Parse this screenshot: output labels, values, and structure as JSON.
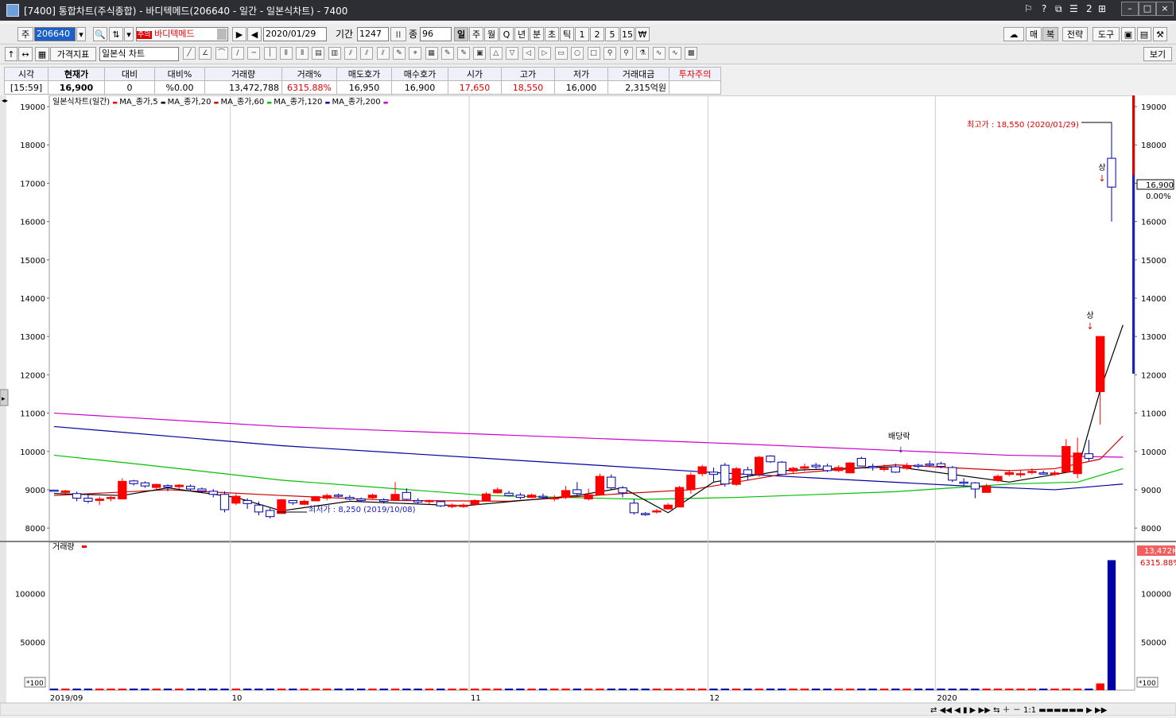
{
  "window": {
    "title": "[7400] 통합차트(주식종합) - 바디텍메드(206640 - 일간 - 일본식차트) - 7400",
    "controls": [
      "?",
      "2"
    ],
    "buttons": [
      "–",
      "□",
      "×"
    ]
  },
  "toolbar1": {
    "market_label": "주",
    "code": "206640",
    "warn_badge": "주의",
    "stock_name": "바디텍메드",
    "date": "2020/01/29",
    "period_label": "기간",
    "period_value": "1247",
    "count_label": "종",
    "count_value": "96",
    "intervals": [
      "일",
      "주",
      "월",
      "Q",
      "년",
      "분",
      "초",
      "틱",
      "1",
      "2",
      "5",
      "15",
      "₩"
    ],
    "right_buttons": [
      "매",
      "복",
      "전략",
      "도구"
    ]
  },
  "toolbar2": {
    "indicator_label": "가격지표",
    "chart_type": "일본식 차트",
    "view_button": "보기"
  },
  "quote": {
    "headers": [
      "시각",
      "현재가",
      "대비",
      "대비%",
      "거래량",
      "거래%",
      "매도호가",
      "매수호가",
      "시가",
      "고가",
      "저가",
      "거래대금",
      "투자주의"
    ],
    "values": [
      "[15:59]",
      "16,900",
      "0",
      "%0.00",
      "13,472,788",
      "6315.88%",
      "16,950",
      "16,900",
      "17,650",
      "18,550",
      "16,000",
      "2,315억원",
      ""
    ]
  },
  "colors": {
    "up": "#ff0000",
    "down": "#0000aa",
    "ma5": "#000000",
    "ma20": "#d00000",
    "ma60": "#00c000",
    "ma120": "#0000a0",
    "ma200": "#cc00cc"
  },
  "chart_data": {
    "type": "candlestick",
    "legend": [
      "일본식차트(일간)",
      "MA_종가,5",
      "MA_종가,20",
      "MA_종가,60",
      "MA_종가,120",
      "MA_종가,200"
    ],
    "volume_legend": "거래량",
    "price_ticks": [
      8000,
      9000,
      10000,
      11000,
      12000,
      13000,
      14000,
      15000,
      16000,
      17000,
      18000,
      19000
    ],
    "volume_ticks": [
      50000,
      100000
    ],
    "volume_unit": "*100",
    "x_labels": [
      "2019/09",
      "10",
      "11",
      "12",
      "2020"
    ],
    "x_label_index": [
      0,
      16,
      37,
      58,
      78
    ],
    "last_price_label": "16,900",
    "last_change_label": "0.00%",
    "last_volume_label": "13,472K",
    "last_volume_pct": "6315.88%",
    "high_annotation": "최고가 : 18,550 (2020/01/29)",
    "low_annotation": "최저가 : 8,250 (2019/10/08)",
    "dividend_annotation": "배당락",
    "limit_up_label": "상",
    "candles": [
      [
        8990,
        8990,
        8980,
        8980,
        140
      ],
      [
        8930,
        9000,
        8900,
        8970,
        160
      ],
      [
        8900,
        8950,
        8700,
        8780,
        340
      ],
      [
        8780,
        8880,
        8650,
        8700,
        180
      ],
      [
        8720,
        8820,
        8600,
        8760,
        140
      ],
      [
        8780,
        8830,
        8700,
        8800,
        220
      ],
      [
        8760,
        9300,
        8760,
        9220,
        620
      ],
      [
        9230,
        9260,
        9110,
        9160,
        230
      ],
      [
        9180,
        9220,
        9050,
        9100,
        200
      ],
      [
        9060,
        9160,
        8990,
        9140,
        190
      ],
      [
        9110,
        9140,
        8960,
        9070,
        160
      ],
      [
        9080,
        9150,
        9010,
        9120,
        170
      ],
      [
        9090,
        9140,
        8960,
        9020,
        200
      ],
      [
        9020,
        9060,
        8930,
        8970,
        150
      ],
      [
        8960,
        9020,
        8800,
        8880,
        190
      ],
      [
        8880,
        8960,
        8410,
        8480,
        390
      ],
      [
        8650,
        8890,
        8600,
        8830,
        310
      ],
      [
        8720,
        8780,
        8500,
        8640,
        260
      ],
      [
        8600,
        8690,
        8330,
        8420,
        290
      ],
      [
        8460,
        8520,
        8250,
        8300,
        360
      ],
      [
        8380,
        8760,
        8380,
        8740,
        410
      ],
      [
        8720,
        8730,
        8600,
        8660,
        180
      ],
      [
        8620,
        8740,
        8600,
        8700,
        170
      ],
      [
        8710,
        8840,
        8700,
        8820,
        190
      ],
      [
        8780,
        8900,
        8720,
        8850,
        180
      ],
      [
        8860,
        8900,
        8800,
        8840,
        150
      ],
      [
        8800,
        8860,
        8730,
        8760,
        140
      ],
      [
        8760,
        8800,
        8690,
        8720,
        150
      ],
      [
        8790,
        8900,
        8740,
        8860,
        160
      ],
      [
        8740,
        8780,
        8640,
        8700,
        150
      ],
      [
        8740,
        9200,
        8740,
        8880,
        560
      ],
      [
        8930,
        9040,
        8720,
        8750,
        310
      ],
      [
        8720,
        8780,
        8630,
        8680,
        180
      ],
      [
        8690,
        8740,
        8620,
        8720,
        160
      ],
      [
        8690,
        8710,
        8550,
        8580,
        200
      ],
      [
        8560,
        8640,
        8520,
        8600,
        180
      ],
      [
        8560,
        8640,
        8530,
        8600,
        170
      ],
      [
        8620,
        8750,
        8590,
        8720,
        210
      ],
      [
        8720,
        8940,
        8700,
        8890,
        330
      ],
      [
        8920,
        9060,
        8900,
        9000,
        290
      ],
      [
        8910,
        8970,
        8820,
        8850,
        180
      ],
      [
        8860,
        8920,
        8750,
        8800,
        170
      ],
      [
        8800,
        8900,
        8780,
        8860,
        160
      ],
      [
        8830,
        8900,
        8770,
        8810,
        170
      ],
      [
        8780,
        8860,
        8700,
        8790,
        180
      ],
      [
        8800,
        9100,
        8760,
        8980,
        460
      ],
      [
        9000,
        9200,
        8830,
        8900,
        520
      ],
      [
        8760,
        9030,
        8720,
        8870,
        280
      ],
      [
        8870,
        9420,
        8850,
        9350,
        1060
      ],
      [
        9330,
        9400,
        9000,
        9050,
        720
      ],
      [
        9050,
        9100,
        8800,
        8920,
        620
      ],
      [
        8650,
        8760,
        8350,
        8400,
        640
      ],
      [
        8380,
        8420,
        8320,
        8370,
        420
      ],
      [
        8420,
        8500,
        8380,
        8450,
        350
      ],
      [
        8500,
        8650,
        8480,
        8600,
        380
      ],
      [
        8550,
        9100,
        8550,
        9060,
        760
      ],
      [
        9000,
        9450,
        8900,
        9380,
        1040
      ],
      [
        9420,
        9650,
        9350,
        9600,
        780
      ],
      [
        9460,
        9580,
        9200,
        9400,
        650
      ],
      [
        9640,
        9700,
        9080,
        9150,
        1030
      ],
      [
        9140,
        9600,
        9100,
        9550,
        540
      ],
      [
        9520,
        9600,
        9250,
        9400,
        420
      ],
      [
        9400,
        9880,
        9340,
        9850,
        680
      ],
      [
        9880,
        9900,
        9700,
        9730,
        420
      ],
      [
        9720,
        9750,
        9380,
        9400,
        380
      ],
      [
        9490,
        9600,
        9420,
        9560,
        300
      ],
      [
        9560,
        9680,
        9480,
        9600,
        240
      ],
      [
        9640,
        9700,
        9550,
        9600,
        220
      ],
      [
        9620,
        9680,
        9460,
        9500,
        200
      ],
      [
        9500,
        9640,
        9460,
        9580,
        190
      ],
      [
        9440,
        9720,
        9440,
        9700,
        380
      ],
      [
        9820,
        9860,
        9610,
        9620,
        340
      ],
      [
        9610,
        9680,
        9500,
        9590,
        230
      ],
      [
        9530,
        9660,
        9480,
        9560,
        220
      ],
      [
        9600,
        9680,
        9440,
        9460,
        410
      ],
      [
        9560,
        9700,
        9520,
        9620,
        260
      ],
      [
        9640,
        9680,
        9560,
        9610,
        220
      ],
      [
        9670,
        9760,
        9600,
        9640,
        260
      ],
      [
        9680,
        9730,
        9560,
        9610,
        210
      ],
      [
        9580,
        9620,
        9200,
        9250,
        290
      ],
      [
        9200,
        9300,
        9100,
        9180,
        210
      ],
      [
        9180,
        9200,
        8780,
        9020,
        200
      ],
      [
        8930,
        9160,
        8930,
        9100,
        220
      ],
      [
        9240,
        9400,
        9200,
        9350,
        390
      ],
      [
        9400,
        9520,
        9350,
        9450,
        290
      ],
      [
        9420,
        9500,
        9320,
        9420,
        250
      ],
      [
        9460,
        9560,
        9400,
        9480,
        230
      ],
      [
        9440,
        9500,
        9400,
        9420,
        210
      ],
      [
        9400,
        9500,
        9360,
        9440,
        260
      ],
      [
        9460,
        10320,
        9460,
        10130,
        1470
      ],
      [
        9420,
        10360,
        9300,
        9960,
        880
      ],
      [
        9940,
        10300,
        9750,
        9820,
        740
      ],
      [
        11560,
        11560,
        10700,
        13000,
        6970
      ],
      [
        17650,
        18550,
        16000,
        16900,
        134728
      ]
    ],
    "ma_series": {
      "ma200": [
        [
          0,
          11000
        ],
        [
          20,
          10650
        ],
        [
          60,
          10200
        ],
        [
          84,
          9900
        ],
        [
          94,
          9850
        ]
      ],
      "ma120": [
        [
          0,
          10650
        ],
        [
          20,
          10150
        ],
        [
          58,
          9450
        ],
        [
          80,
          9100
        ],
        [
          88,
          9000
        ],
        [
          94,
          9150
        ]
      ],
      "ma60": [
        [
          0,
          9900
        ],
        [
          8,
          9650
        ],
        [
          20,
          9250
        ],
        [
          38,
          8850
        ],
        [
          52,
          8750
        ],
        [
          60,
          8800
        ],
        [
          74,
          8950
        ],
        [
          84,
          9150
        ],
        [
          90,
          9200
        ],
        [
          94,
          9550
        ]
      ],
      "ma20": [
        [
          0,
          8850
        ],
        [
          10,
          9000
        ],
        [
          20,
          8850
        ],
        [
          30,
          8720
        ],
        [
          40,
          8700
        ],
        [
          50,
          8900
        ],
        [
          56,
          9000
        ],
        [
          64,
          9400
        ],
        [
          74,
          9650
        ],
        [
          84,
          9500
        ],
        [
          88,
          9550
        ],
        [
          92,
          9800
        ],
        [
          94,
          10400
        ]
      ],
      "ma5": [
        [
          0,
          8900
        ],
        [
          6,
          8850
        ],
        [
          10,
          9050
        ],
        [
          16,
          8800
        ],
        [
          20,
          8450
        ],
        [
          26,
          8700
        ],
        [
          36,
          8580
        ],
        [
          46,
          8850
        ],
        [
          50,
          9050
        ],
        [
          54,
          8400
        ],
        [
          58,
          9200
        ],
        [
          64,
          9500
        ],
        [
          74,
          9600
        ],
        [
          84,
          9200
        ],
        [
          88,
          9400
        ],
        [
          90,
          9500
        ],
        [
          92,
          11600
        ],
        [
          94,
          13300
        ]
      ]
    }
  }
}
